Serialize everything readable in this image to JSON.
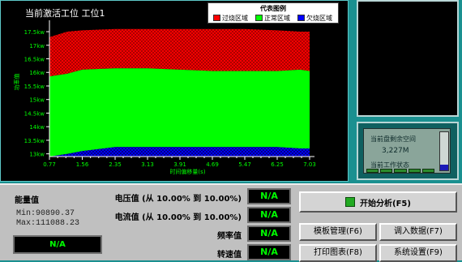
{
  "chart_data": {
    "type": "area",
    "title": "当前激活工位 工位1",
    "xlabel": "时间偏移量(s)",
    "ylabel": "功率值",
    "x_ticks": [
      "0.77",
      "1.56",
      "2.35",
      "3.13",
      "3.91",
      "4.69",
      "5.47",
      "6.25",
      "7.03"
    ],
    "y_ticks": [
      "13kw",
      "13.5kw",
      "14kw",
      "14.5kw",
      "15kw",
      "15.5kw",
      "16kw",
      "16.5kw",
      "17kw",
      "17.5kw"
    ],
    "ylim": [
      12.9,
      17.8
    ],
    "xlim": [
      0.77,
      7.03
    ],
    "legend": {
      "title": "代表图例",
      "items": [
        {
          "label": "过烧区域",
          "color": "#ff0000"
        },
        {
          "label": "正常区域",
          "color": "#00ff00"
        },
        {
          "label": "欠烧区域",
          "color": "#0000ff"
        }
      ]
    },
    "x": [
      0.77,
      1.2,
      1.56,
      2.35,
      3.13,
      3.91,
      4.69,
      5.47,
      6.25,
      6.8,
      7.03
    ],
    "upper": [
      17.3,
      17.5,
      17.55,
      17.6,
      17.6,
      17.6,
      17.6,
      17.6,
      17.55,
      17.5,
      17.5
    ],
    "normal_top": [
      15.85,
      15.95,
      16.1,
      16.15,
      16.15,
      16.1,
      16.05,
      16.05,
      16.05,
      16.1,
      16.05
    ],
    "lower": [
      12.9,
      13.0,
      13.1,
      13.25,
      13.25,
      13.25,
      13.25,
      13.25,
      13.25,
      13.2,
      13.2
    ],
    "base": 12.9,
    "grid": false
  },
  "status": {
    "disk_label": "当前盘剩余空间",
    "disk_value": "3,227M",
    "work_label": "当前工作状态",
    "segments": 5,
    "disk_free_fraction": 0.15
  },
  "energy": {
    "label": "能量值",
    "min": "Min:90890.37",
    "max": "Max:111088.23",
    "value": "N/A"
  },
  "params": [
    {
      "label": "电压值 (从 10.00% 到 10.00%)",
      "value": "N/A"
    },
    {
      "label": "电流值 (从 10.00% 到 10.00%)",
      "value": "N/A"
    },
    {
      "label": "频率值",
      "value": "N/A"
    },
    {
      "label": "转速值",
      "value": "N/A"
    }
  ],
  "buttons": {
    "start": "开始分析(F5)",
    "template": "模板管理(F6)",
    "import": "调入数据(F7)",
    "print": "打印图表(F8)",
    "settings": "系统设置(F9)"
  },
  "colors": {
    "over": "#ff0000",
    "normal": "#00ff00",
    "under": "#0000ff",
    "lcd_green": "#00ff00",
    "panel_teal": "#1a9090"
  }
}
